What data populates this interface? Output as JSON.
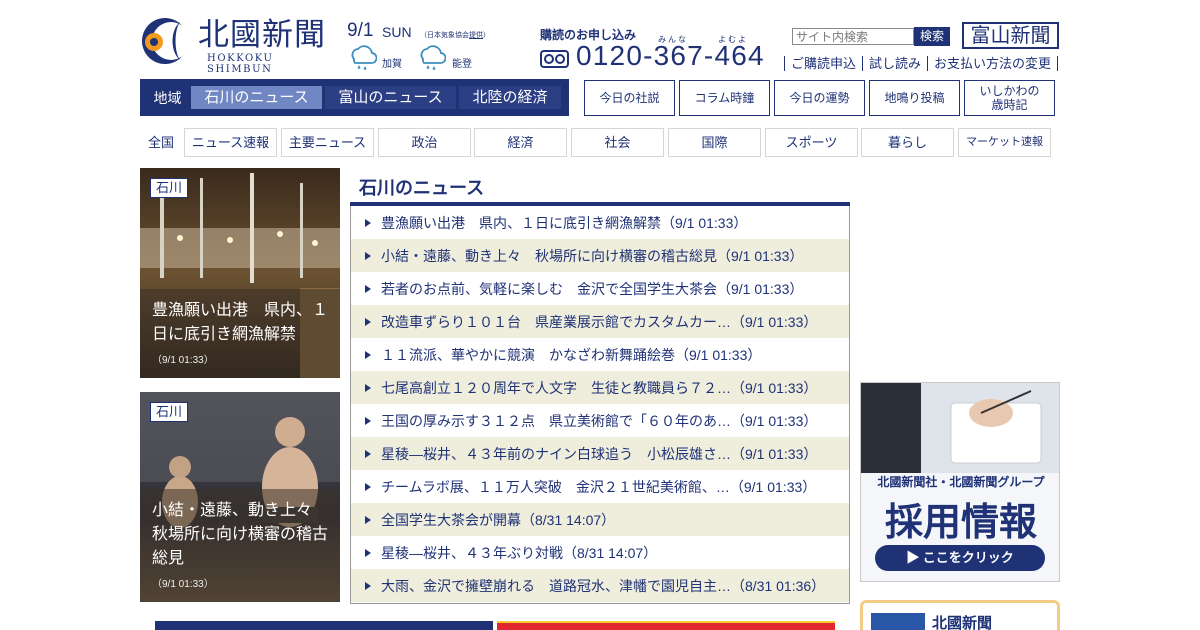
{
  "header": {
    "logo_title": "北國新聞",
    "logo_sub": "HOKKOKU SHIMBUN",
    "date": "9/1",
    "weekday": "SUN",
    "weather_source_prefix": "（日本気象協会",
    "weather_source_link": "提供",
    "weather_source_suffix": "）",
    "weather": [
      {
        "label": "加賀",
        "icon": "rain-cloud-icon"
      },
      {
        "label": "能登",
        "icon": "rain-cloud-icon"
      }
    ],
    "subscribe_title": "購読のお申し込み",
    "phone_ruby": "みんな　　　よむよ",
    "phone": "0120-367-464",
    "search_placeholder": "サイト内検索",
    "search_button": "検索",
    "toyama_link": "富山新聞",
    "util_links": [
      "ご購読申込",
      "試し読み",
      "お支払い方法の変更"
    ]
  },
  "region_nav": {
    "label": "地域",
    "tabs": [
      "石川のニュース",
      "富山のニュース",
      "北陸の経済"
    ],
    "active": 0
  },
  "feature_buttons": [
    "今日の社説",
    "コラム時鐘",
    "今日の運勢",
    "地鳴り投稿",
    "いしかわの歳時記"
  ],
  "categories": {
    "all": "全国",
    "tabs": [
      "ニュース速報",
      "主要ニュース",
      "政治",
      "経済",
      "社会",
      "国際",
      "スポーツ",
      "暮らし",
      "マーケット速報"
    ]
  },
  "photo_cards": [
    {
      "tag": "石川",
      "title": "豊漁願い出港　県内、１日に底引き網漁解禁",
      "time": "（9/1 01:33）"
    },
    {
      "tag": "石川",
      "title": "小結・遠藤、動き上々　秋場所に向け横審の稽古総見",
      "time": "（9/1 01:33）"
    }
  ],
  "news": {
    "heading": "石川のニュース",
    "items": [
      "豊漁願い出港　県内、１日に底引き網漁解禁（9/1 01:33）",
      "小結・遠藤、動き上々　秋場所に向け横審の稽古総見（9/1 01:33）",
      "若者のお点前、気軽に楽しむ　金沢で全国学生大茶会（9/1 01:33）",
      "改造車ずらり１０１台　県産業展示館でカスタムカー…（9/1 01:33）",
      "１１流派、華やかに競演　かなざわ新舞踊絵巻（9/1 01:33）",
      "七尾高創立１２０周年で人文字　生徒と教職員ら７２…（9/1 01:33）",
      "王国の厚み示す３１２点　県立美術館で「６０年のあ…（9/1 01:33）",
      "星稜―桜井、４３年前のナイン白球追う　小松辰雄さ…（9/1 01:33）",
      "チームラボ展、１１万人突破　金沢２１世紀美術館、…（9/1 01:33）",
      "全国学生大茶会が開幕（8/31 14:07）",
      "星稜―桜井、４３年ぶり対戦（8/31 14:07）",
      "大雨、金沢で擁壁崩れる　道路冠水、津幡で園児自主…（8/31 01:36）"
    ]
  },
  "recruit_ad": {
    "sub": "北國新聞社・北國新聞グループ",
    "title": "採用情報",
    "button": "▶ ここをクリック"
  },
  "app_box": {
    "title": "北國新聞"
  },
  "colors": {
    "brand_navy": "#1f3276",
    "active_tab": "#7087c4",
    "row_alt": "#efeddc",
    "logo_orange": "#f39a1e"
  }
}
